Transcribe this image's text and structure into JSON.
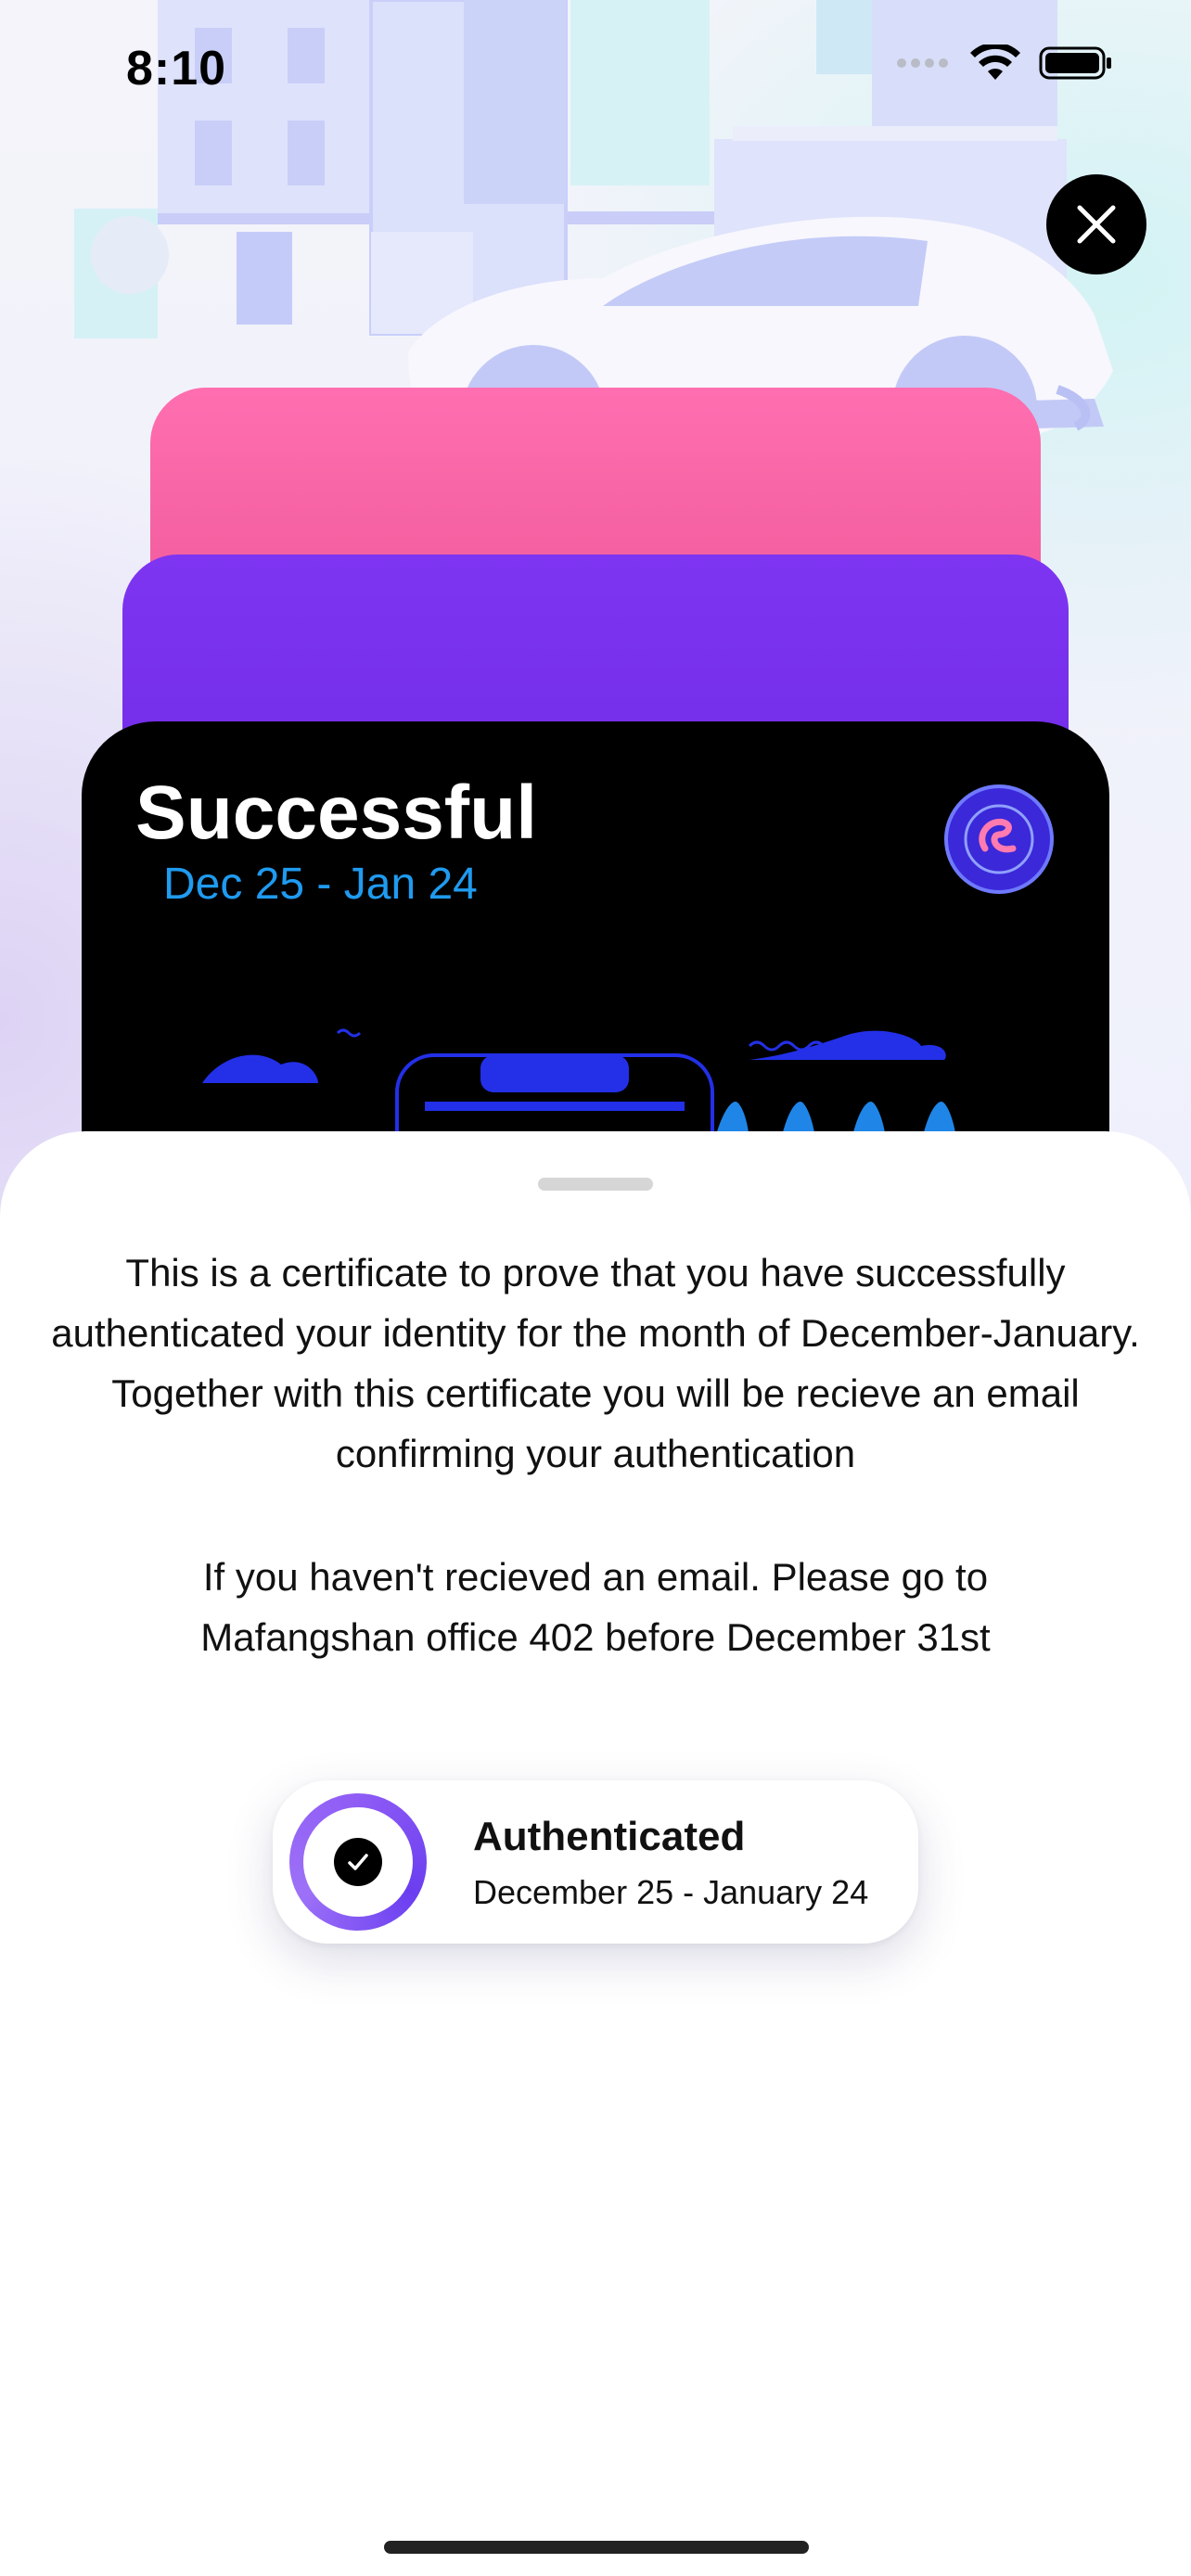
{
  "status_bar": {
    "time": "8:10"
  },
  "icons": {
    "close": "close-icon",
    "wifi": "wifi-icon",
    "battery": "battery-icon",
    "cellular": "cellular-icon",
    "check": "checkmark-icon",
    "emblem": "university-emblem-icon"
  },
  "card": {
    "title": "Successful",
    "date_range": "Dec 25 - Jan 24"
  },
  "sheet": {
    "paragraph1": "This is a certificate to prove that you have successfully authenticated your identity for the month of December-January.",
    "paragraph2": "Together with this certificate you will be recieve an email confirming your authentication",
    "paragraph3": "If you haven't recieved an email. Please go to Mafangshan office 402 before December 31st"
  },
  "auth_badge": {
    "title": "Authenticated",
    "date_range": "December 25 - January 24"
  },
  "colors": {
    "card_pink": "#ff6fb0",
    "card_purple": "#7e35f2",
    "card_black": "#000000",
    "date_blue": "#1f9bf0",
    "ring_purple": "#8f5cf5"
  }
}
